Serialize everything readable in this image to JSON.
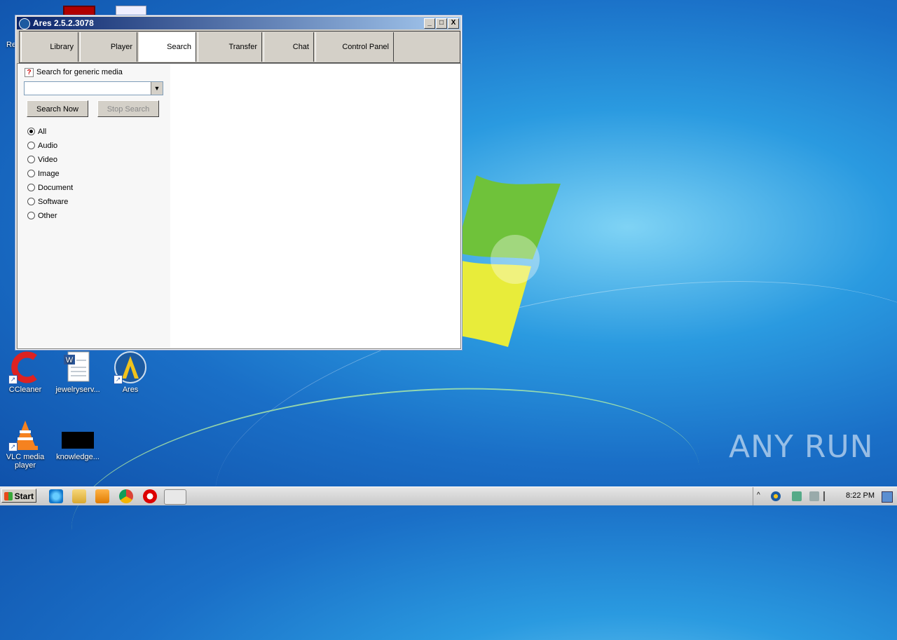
{
  "window": {
    "title": "Ares 2.5.2.3078",
    "minimize": "_",
    "maximize": "□",
    "close": "X"
  },
  "tabs": [
    {
      "label": "Library"
    },
    {
      "label": "Player"
    },
    {
      "label": "Search",
      "active": true
    },
    {
      "label": "Transfer"
    },
    {
      "label": "Chat"
    },
    {
      "label": "Control Panel"
    }
  ],
  "search": {
    "heading": "Search for generic media",
    "query_value": "",
    "search_now": "Search Now",
    "stop_search": "Stop Search",
    "media_types": [
      {
        "label": "All",
        "selected": true
      },
      {
        "label": "Audio"
      },
      {
        "label": "Video"
      },
      {
        "label": "Image"
      },
      {
        "label": "Document"
      },
      {
        "label": "Software"
      },
      {
        "label": "Other"
      }
    ]
  },
  "desktop": {
    "icons": [
      {
        "label": "CCleaner",
        "icon": "ccleaner-icon"
      },
      {
        "label": "jewelryserv...",
        "icon": "word-document-icon"
      },
      {
        "label": "Ares",
        "icon": "ares-icon"
      },
      {
        "label": "VLC media player",
        "icon": "vlc-icon"
      },
      {
        "label": "knowledge...",
        "icon": "black-image-icon"
      }
    ],
    "partial_label": "Re",
    "watermark": "ANY RUN"
  },
  "taskbar": {
    "start": "Start",
    "clock": "8:22 PM",
    "pinned": [
      "internet-explorer-icon",
      "explorer-folder-icon",
      "media-player-icon",
      "chrome-icon",
      "opera-icon",
      "ares-taskbar-icon"
    ]
  },
  "colors": {
    "title_gradient_start": "#0a246a",
    "title_gradient_end": "#a6caf0",
    "desktop_blue": "#1a6fc7"
  }
}
